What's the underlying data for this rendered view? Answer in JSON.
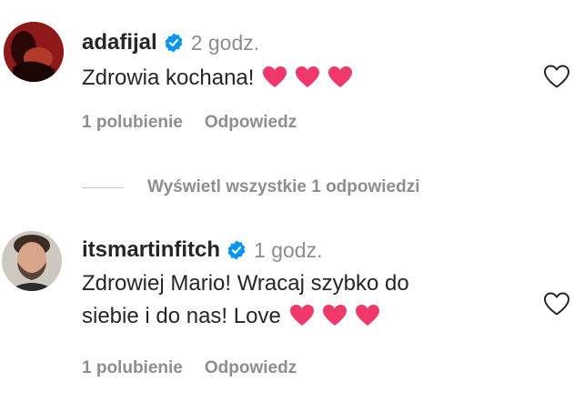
{
  "comments": [
    {
      "username": "adafijal",
      "time": "2 godz.",
      "text_lines": [
        "Zdrowia kochana!"
      ],
      "likes": "1 polubienie",
      "reply": "Odpowiedz",
      "hearts": 3
    },
    {
      "username": "itsmartinfitch",
      "time": "1 godz.",
      "text_lines": [
        "Zdrowiej Mario! Wracaj szybko do",
        "siebie i do nas! Love"
      ],
      "likes": "1 polubienie",
      "reply": "Odpowiedz",
      "hearts": 3
    }
  ],
  "view_replies": "Wyświetl wszystkie 1 odpowiedzi",
  "icons": {
    "verified": "verified-badge-icon",
    "like": "heart-outline-icon",
    "emoji": "pink-heart-emoji"
  },
  "colors": {
    "verified_blue": "#0095f6",
    "heart_pink": "#f0386b",
    "muted_text": "#8e8e8e",
    "primary_text": "#262626"
  }
}
